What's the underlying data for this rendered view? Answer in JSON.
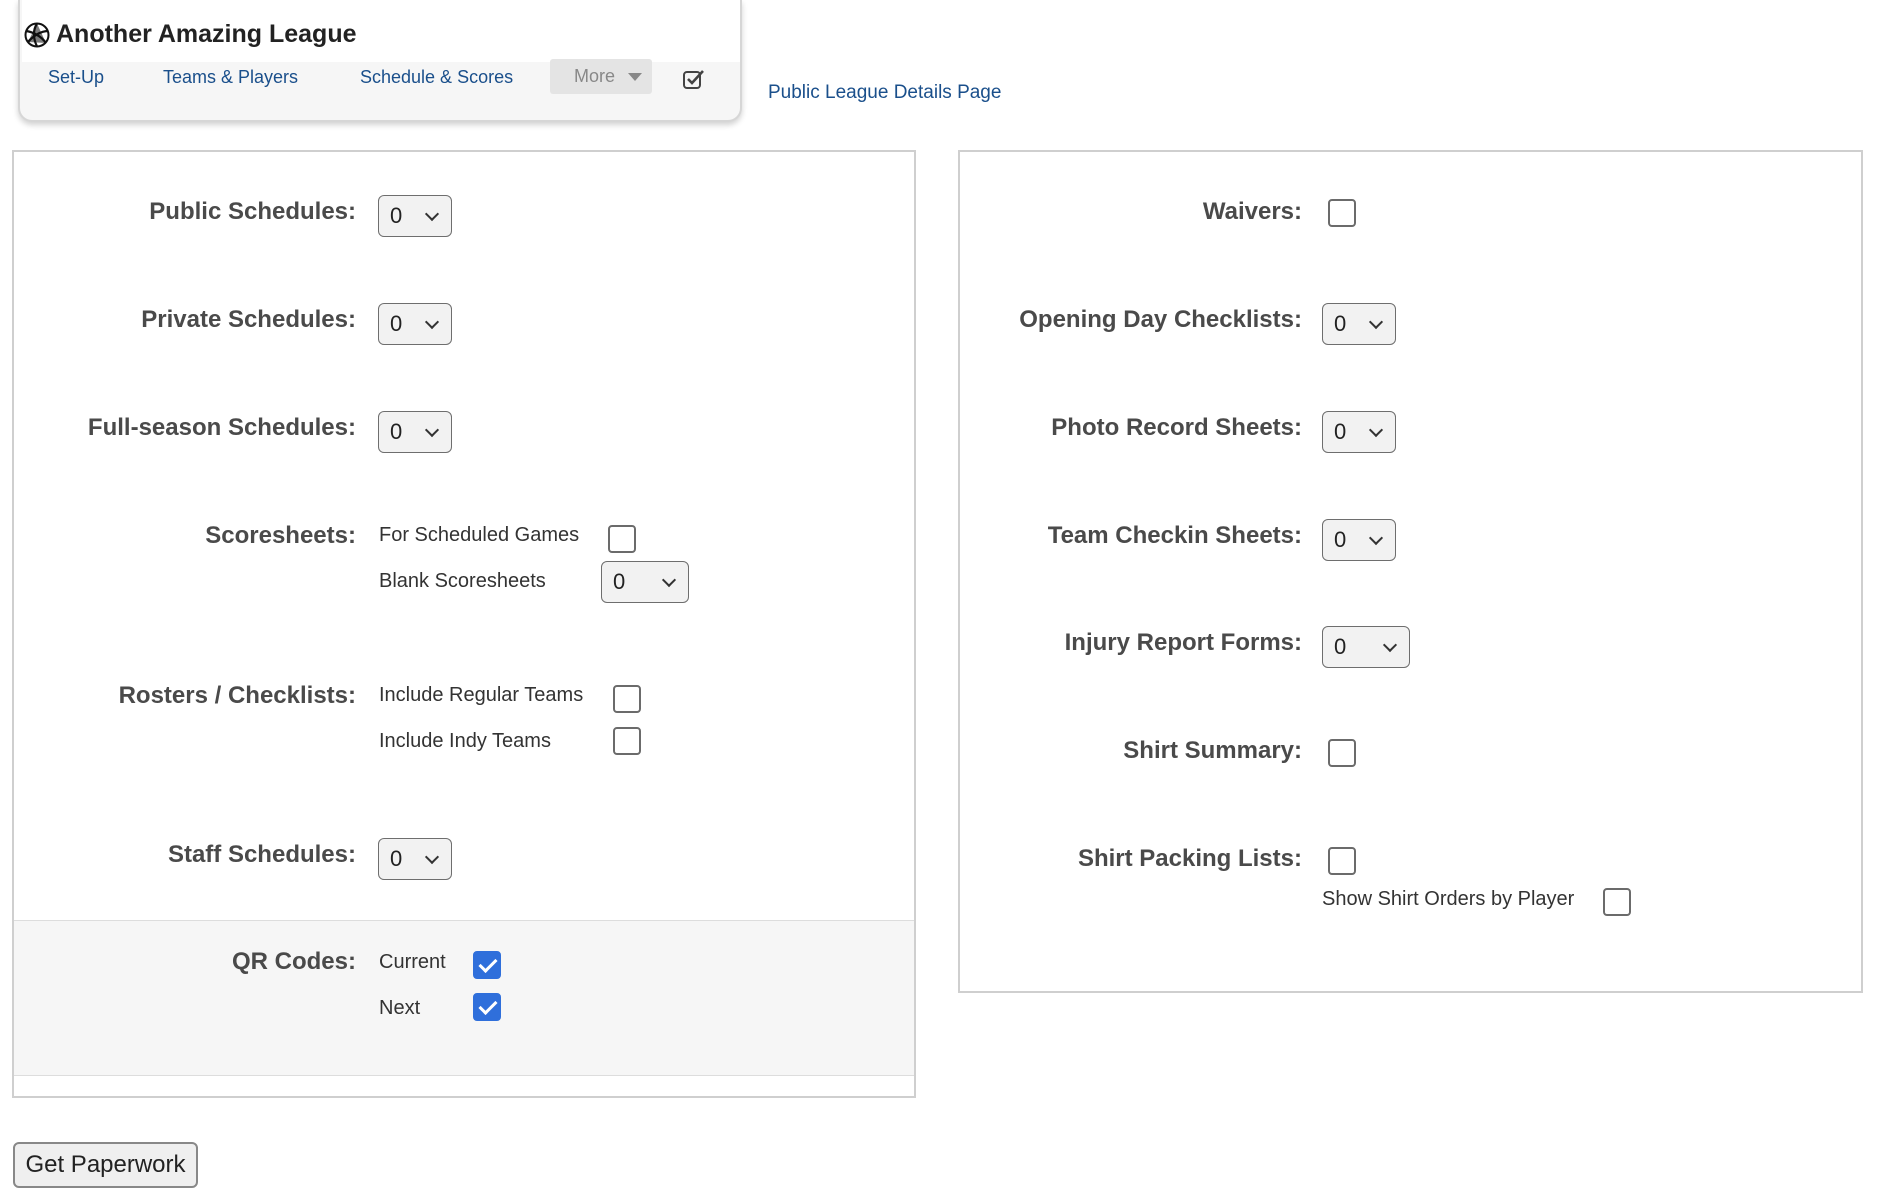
{
  "header": {
    "league_title": "Another Amazing League",
    "nav": [
      "Set-Up",
      "Teams & Players",
      "Schedule & Scores"
    ],
    "more_label": "More",
    "public_link": "Public League Details Page"
  },
  "left_panel": {
    "public_schedules": {
      "label": "Public Schedules:",
      "value": "0"
    },
    "private_schedules": {
      "label": "Private Schedules:",
      "value": "0"
    },
    "full_season_schedules": {
      "label": "Full-season Schedules:",
      "value": "0"
    },
    "scoresheets": {
      "label": "Scoresheets:",
      "scheduled_label": "For Scheduled Games",
      "scheduled_checked": false,
      "blank_label": "Blank Scoresheets",
      "blank_value": "0"
    },
    "rosters": {
      "label": "Rosters / Checklists:",
      "regular_label": "Include Regular Teams",
      "regular_checked": false,
      "indy_label": "Include Indy Teams",
      "indy_checked": false
    },
    "staff_schedules": {
      "label": "Staff Schedules:",
      "value": "0"
    },
    "qr_codes": {
      "label": "QR Codes:",
      "current_label": "Current",
      "current_checked": true,
      "next_label": "Next",
      "next_checked": true
    }
  },
  "right_panel": {
    "waivers": {
      "label": "Waivers:",
      "checked": false
    },
    "opening_day": {
      "label": "Opening Day Checklists:",
      "value": "0"
    },
    "photo_record": {
      "label": "Photo Record Sheets:",
      "value": "0"
    },
    "team_checkin": {
      "label": "Team Checkin Sheets:",
      "value": "0"
    },
    "injury_report": {
      "label": "Injury Report Forms:",
      "value": "0"
    },
    "shirt_summary": {
      "label": "Shirt Summary:",
      "checked": false
    },
    "shirt_packing": {
      "label": "Shirt Packing Lists:",
      "checked": false,
      "by_player_label": "Show Shirt Orders by Player",
      "by_player_checked": false
    }
  },
  "actions": {
    "get_paperwork": "Get Paperwork"
  },
  "colors": {
    "link": "#1a4f8b",
    "checkbox_checked": "#2f6fdb",
    "label": "#4a4a4a"
  }
}
